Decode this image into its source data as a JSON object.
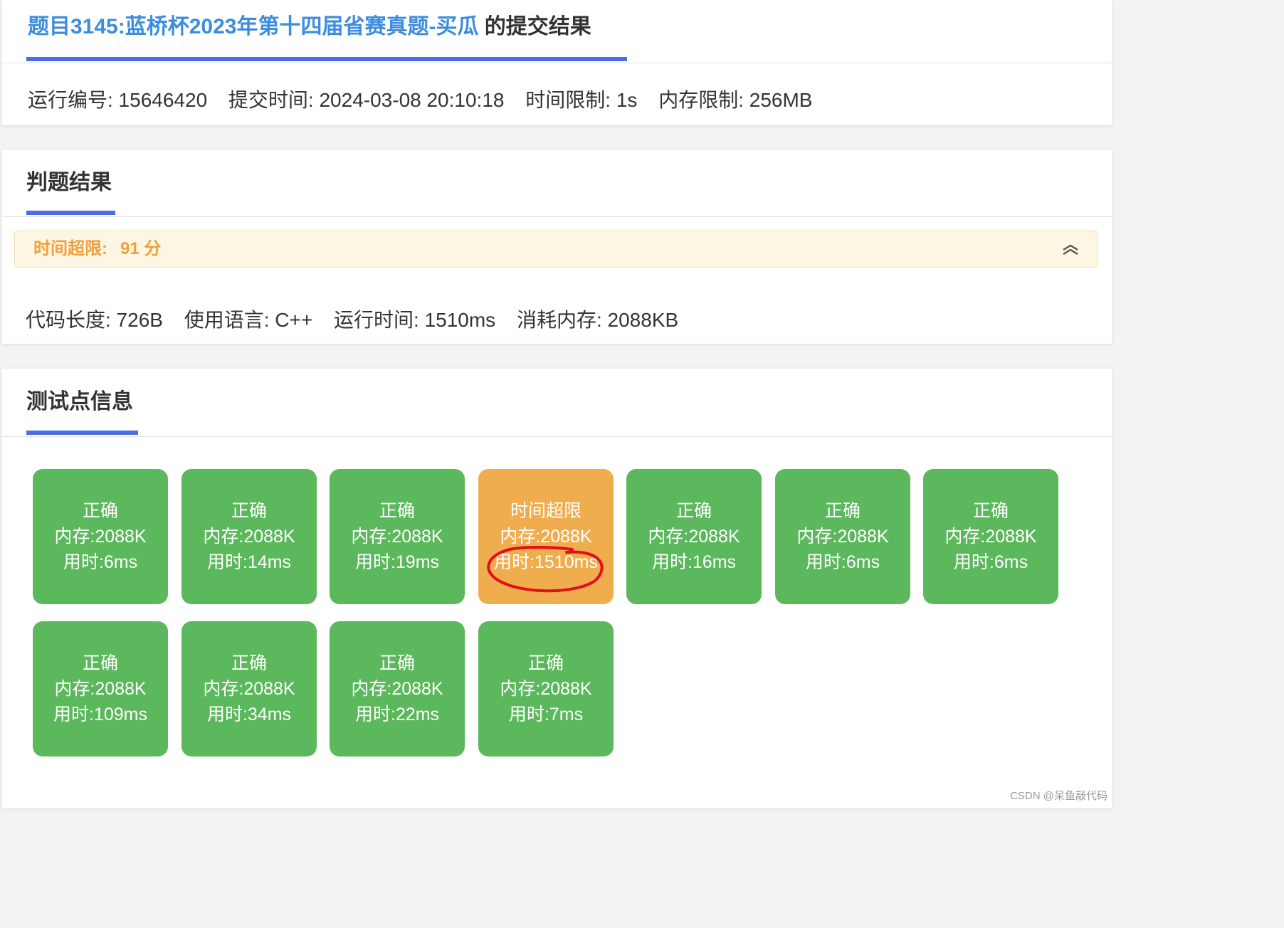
{
  "header": {
    "problem_link": "题目3145:蓝桥杯2023年第十四届省赛真题-买瓜",
    "title_suffix": " 的提交结果",
    "run_id": "运行编号: 15646420",
    "submit_time": "提交时间: 2024-03-08 20:10:18",
    "time_limit": "时间限制: 1s",
    "memory_limit": "内存限制: 256MB"
  },
  "judge": {
    "section_title": "判题结果",
    "status_label": "时间超限:",
    "score": "91 分",
    "code_length": "代码长度: 726B",
    "language": "使用语言: C++",
    "run_time": "运行时间: 1510ms",
    "memory_used": "消耗内存: 2088KB"
  },
  "testcases": {
    "section_title": "测试点信息",
    "items": [
      {
        "status": "正确",
        "memory": "内存:2088K",
        "time": "用时:6ms"
      },
      {
        "status": "正确",
        "memory": "内存:2088K",
        "time": "用时:14ms"
      },
      {
        "status": "正确",
        "memory": "内存:2088K",
        "time": "用时:19ms"
      },
      {
        "status": "时间超限",
        "memory": "内存:2088K",
        "time": "用时:1510ms"
      },
      {
        "status": "正确",
        "memory": "内存:2088K",
        "time": "用时:16ms"
      },
      {
        "status": "正确",
        "memory": "内存:2088K",
        "time": "用时:6ms"
      },
      {
        "status": "正确",
        "memory": "内存:2088K",
        "time": "用时:6ms"
      },
      {
        "status": "正确",
        "memory": "内存:2088K",
        "time": "用时:109ms"
      },
      {
        "status": "正确",
        "memory": "内存:2088K",
        "time": "用时:34ms"
      },
      {
        "status": "正确",
        "memory": "内存:2088K",
        "time": "用时:22ms"
      },
      {
        "status": "正确",
        "memory": "内存:2088K",
        "time": "用时:7ms"
      }
    ]
  },
  "icons": {
    "collapse": "chevron-up-double-icon",
    "annotation": "red-circle-annotation"
  },
  "colors": {
    "accent": "#4a6ee0",
    "link": "#3c8dde",
    "ok": "#5cb85c",
    "tle": "#f0ad4e",
    "warning_text": "#f0a03c",
    "annotation": "#e0101a"
  },
  "watermark": "CSDN @呆鱼敲代码"
}
